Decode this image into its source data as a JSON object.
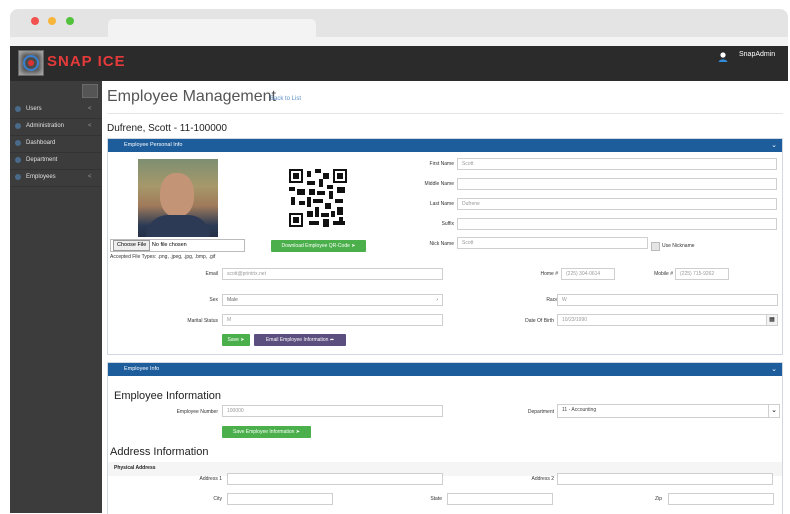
{
  "app": {
    "logo_text": "SNAP ICE",
    "user_name": "SnapAdmin",
    "accent": "#1d5d9c",
    "green": "#4bb04b"
  },
  "sidebar": {
    "items": [
      {
        "label": "Users",
        "icon": "users-icon",
        "chevron": "<"
      },
      {
        "label": "Administration",
        "icon": "admin-icon",
        "chevron": "<"
      },
      {
        "label": "Dashboard",
        "icon": "dashboard-icon",
        "chevron": ""
      },
      {
        "label": "Department",
        "icon": "department-icon",
        "chevron": ""
      },
      {
        "label": "Employees",
        "icon": "employees-icon",
        "chevron": "<"
      }
    ]
  },
  "page": {
    "title": "Employee Management",
    "back_link": "Back to List",
    "employee_heading": "Dufrene, Scott - 11-100000"
  },
  "personal": {
    "panel_title": "Employee Personal Info",
    "choose_file": "Choose File",
    "no_file": "No file chosen",
    "accepted": "Accepted File Types: .png, .jpeg, .jpg, .bmp, .gif",
    "qr_button": "Download Employee QR-Code",
    "first_name_label": "First Name",
    "first_name": "Scott",
    "middle_name_label": "Middle Name",
    "middle_name": "",
    "last_name_label": "Last Name",
    "last_name": "Dufrene",
    "suffix_label": "Suffix",
    "suffix": "",
    "nick_name_label": "Nick Name",
    "nick_name": "Scott",
    "use_nickname_label": "Use Nickname",
    "email_label": "Email",
    "email": "scott@printrix.net",
    "home_label": "Home #",
    "home": "(225) 304-0614",
    "mobile_label": "Mobile #",
    "mobile": "(225) 715-9262",
    "sex_label": "Sex",
    "sex": "Male",
    "race_label": "Race",
    "race": "W",
    "marital_label": "Marital Status",
    "marital": "M",
    "dob_label": "Date Of Birth",
    "dob": "10/23/1990",
    "save_button": "Save",
    "email_button": "Email Employee Information"
  },
  "employee_info": {
    "panel_title": "Employee Info",
    "section_title": "Employee Information",
    "number_label": "Employee Number",
    "number": "100000",
    "department_label": "Department",
    "department": "11 - Accounting",
    "save_button": "Save Employee Information",
    "address_title": "Address Information",
    "physical_label": "Physical Address",
    "address1_label": "Address 1",
    "address1": "",
    "address2_label": "Address 2",
    "address2": "",
    "city_label": "City",
    "city": "",
    "state_label": "State",
    "state": "",
    "zip_label": "Zip",
    "zip": ""
  }
}
